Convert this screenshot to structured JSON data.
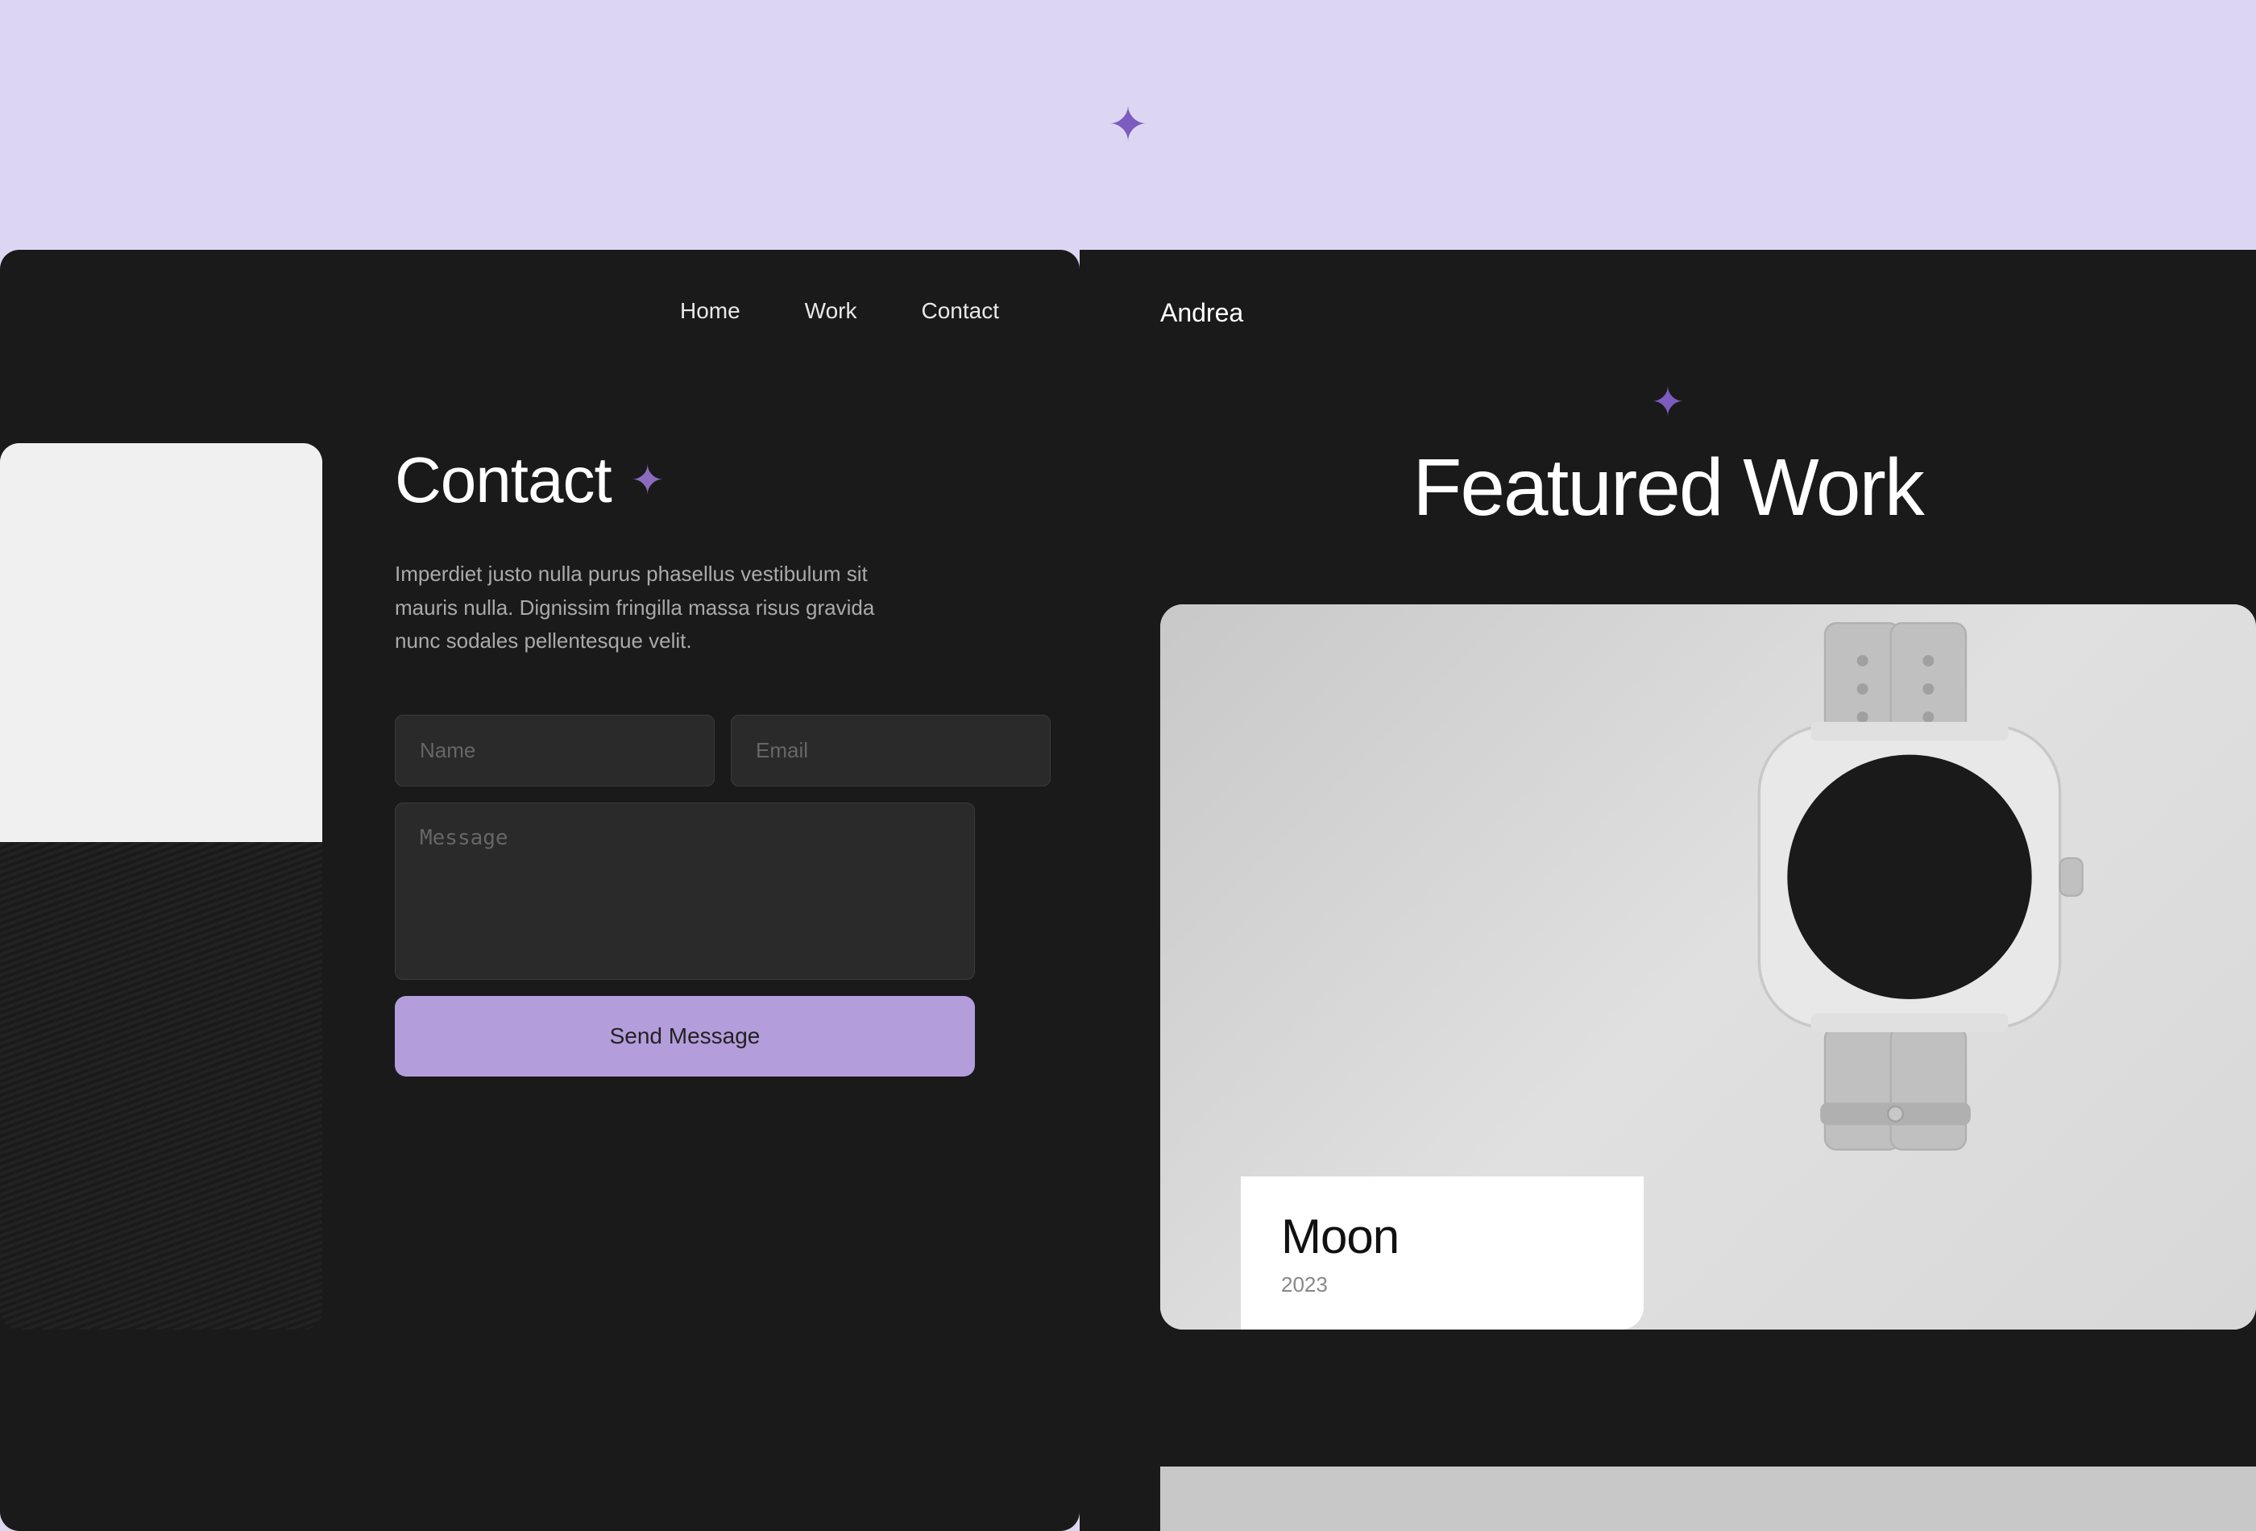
{
  "header": {
    "star_symbol": "✦",
    "background_color": "#ddd6f3",
    "star_color": "#7c5cbf"
  },
  "left_panel": {
    "nav": {
      "items": [
        {
          "label": "Home",
          "href": "#"
        },
        {
          "label": "Work",
          "href": "#"
        },
        {
          "label": "Contact",
          "href": "#"
        }
      ]
    },
    "contact": {
      "title": "Contact",
      "star": "✦",
      "description": "Imperdiet justo nulla purus phasellus vestibulum sit mauris nulla. Dignissim fringilla massa risus gravida nunc sodales pellentesque velit.",
      "form": {
        "name_placeholder": "Name",
        "email_placeholder": "Email",
        "message_placeholder": "Message",
        "submit_label": "Send Message"
      }
    }
  },
  "right_panel": {
    "brand": "Andrea",
    "featured_star": "✦",
    "featured_title": "Featured Work",
    "watch_card": {
      "project_name": "Moon",
      "year": "2023"
    }
  }
}
